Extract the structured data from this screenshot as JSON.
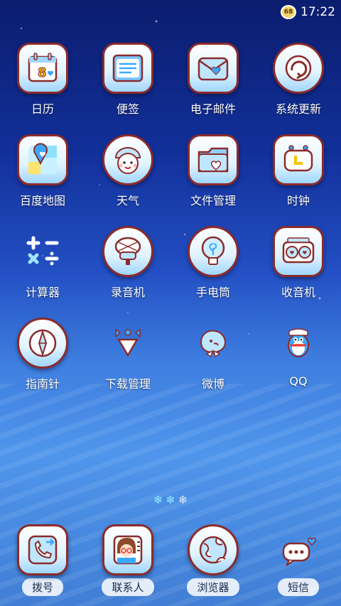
{
  "status_bar": {
    "battery": "68",
    "time": "17:22"
  },
  "apps": [
    {
      "label": "日历",
      "icon": "calendar-icon"
    },
    {
      "label": "便签",
      "icon": "notes-icon"
    },
    {
      "label": "电子邮件",
      "icon": "mail-icon"
    },
    {
      "label": "系统更新",
      "icon": "update-icon"
    },
    {
      "label": "百度地图",
      "icon": "map-icon"
    },
    {
      "label": "天气",
      "icon": "weather-icon"
    },
    {
      "label": "文件管理",
      "icon": "folder-icon"
    },
    {
      "label": "时钟",
      "icon": "clock-icon"
    },
    {
      "label": "计算器",
      "icon": "calculator-icon"
    },
    {
      "label": "录音机",
      "icon": "recorder-icon"
    },
    {
      "label": "手电筒",
      "icon": "flashlight-icon"
    },
    {
      "label": "收音机",
      "icon": "radio-icon"
    },
    {
      "label": "指南针",
      "icon": "compass-icon"
    },
    {
      "label": "下载管理",
      "icon": "download-icon"
    },
    {
      "label": "微博",
      "icon": "weibo-icon"
    },
    {
      "label": "QQ",
      "icon": "qq-icon"
    }
  ],
  "calendar_day": "8",
  "dock": [
    {
      "label": "拨号",
      "icon": "phone-icon"
    },
    {
      "label": "联系人",
      "icon": "contacts-icon"
    },
    {
      "label": "浏览器",
      "icon": "browser-icon"
    },
    {
      "label": "短信",
      "icon": "sms-icon"
    }
  ],
  "colors": {
    "icon_border": "#8b2b2b",
    "accent_blue": "#3ba8ff",
    "page_dot_active": "#8fe8ff"
  }
}
